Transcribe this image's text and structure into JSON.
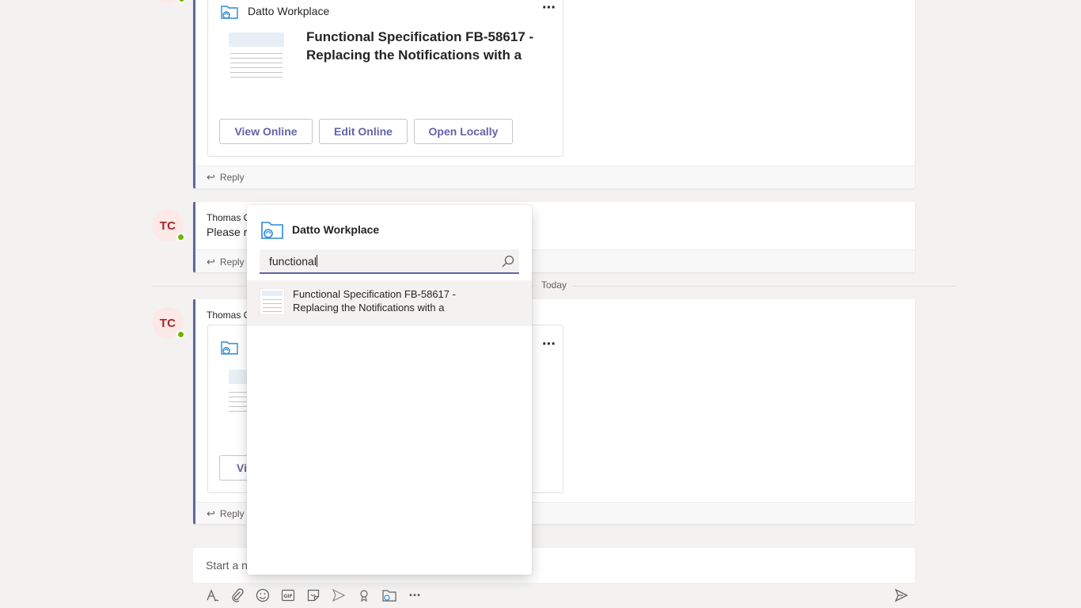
{
  "top_card": {
    "app_name": "Datto Workplace",
    "title": "Functional Specification FB-58617 - Replacing the Notifications with a",
    "buttons": {
      "view": "View Online",
      "edit": "Edit Online",
      "open": "Open Locally"
    },
    "reply": "Reply"
  },
  "second_message": {
    "avatar": "TC",
    "sender": "Thomas C",
    "text": "Please re",
    "reply": "Reply"
  },
  "divider": {
    "label": "Today"
  },
  "third_message": {
    "avatar": "TC",
    "sender": "Thomas C",
    "button_partial": "Vi",
    "reply": "Reply"
  },
  "compose": {
    "placeholder": "Start a n"
  },
  "popup": {
    "title": "Datto Workplace",
    "search_value": "functional",
    "results": [
      {
        "line1": "Functional Specification FB-58617 -",
        "line2": "Replacing the Notifications with a"
      }
    ]
  },
  "icons": {
    "folder": "datto-folder-icon",
    "search": "search-icon",
    "reply": "reply-arrow-icon",
    "more": "more-options-icon",
    "toolbar": [
      "format-icon",
      "attach-icon",
      "emoji-icon",
      "gif-icon",
      "sticker-icon",
      "meet-icon",
      "praise-icon",
      "datto-app-icon",
      "more-apps-icon",
      "send-icon"
    ]
  },
  "colors": {
    "accent": "#6264a7",
    "presence": "#6bb700",
    "avatar_bg": "#fce8e6",
    "avatar_text": "#a4262c"
  }
}
